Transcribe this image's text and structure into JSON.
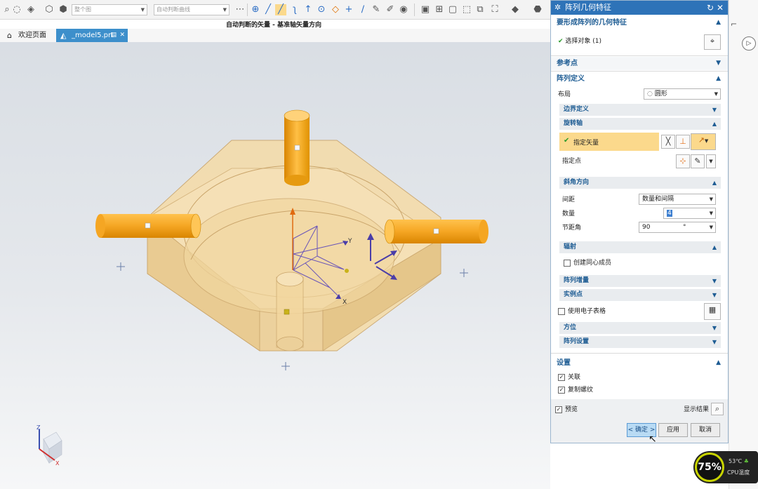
{
  "toolbar": {
    "view_select": "整个图",
    "curve_rule_select": "自动判断曲线"
  },
  "status_line": "自动判断的矢量 - 基准轴矢量方向",
  "tabs": [
    {
      "label": "欢迎页面"
    },
    {
      "label": "_model5.prt"
    }
  ],
  "viewport": {
    "axis_labels": {
      "y": "Y",
      "x": "X",
      "z": "Z"
    },
    "triad_labels": {
      "z": "Z",
      "x": "X"
    }
  },
  "dialog": {
    "title": "阵列几何特征",
    "sections": {
      "geometry": {
        "title": "要形成阵列的几何特征",
        "select_object": "选择对象 (1)"
      },
      "reference_point": {
        "title": "参考点"
      },
      "array_definition": {
        "title": "阵列定义",
        "layout_label": "布局",
        "layout_value": "圆形",
        "boundary": "边界定义",
        "rotation_axis": {
          "title": "旋转轴",
          "specify_vector": "指定矢量",
          "specify_point": "指定点"
        },
        "angle_direction": {
          "title": "斜角方向",
          "spacing_label": "间距",
          "spacing_value": "数量和间隔",
          "count_label": "数量",
          "count_value": "4",
          "pitch_label": "节距角",
          "pitch_value": "90",
          "pitch_unit": "°"
        },
        "radiate": {
          "title": "辐射",
          "concentric": "创建同心成员"
        },
        "array_increment": "阵列增量",
        "instance_points": "实例点",
        "use_spreadsheet": "使用电子表格",
        "orientation": "方位",
        "array_settings": "阵列设置"
      },
      "settings": {
        "title": "设置",
        "associative": "关联",
        "copy_threads": "复制螺纹"
      }
    },
    "preview": "预览",
    "show_result": "显示结果",
    "ok": "< 确定 >",
    "apply": "应用",
    "cancel": "取消"
  },
  "cpu": {
    "percent": "75%",
    "temperature": "53℃",
    "label": "CPU温度"
  },
  "colors": {
    "dialog_title_bg": "#2e73b8",
    "section_text": "#1f5d94",
    "selected_row": "#fbd98c",
    "cylinder": "#f5a623",
    "tab_active": "#3d8fcb"
  }
}
